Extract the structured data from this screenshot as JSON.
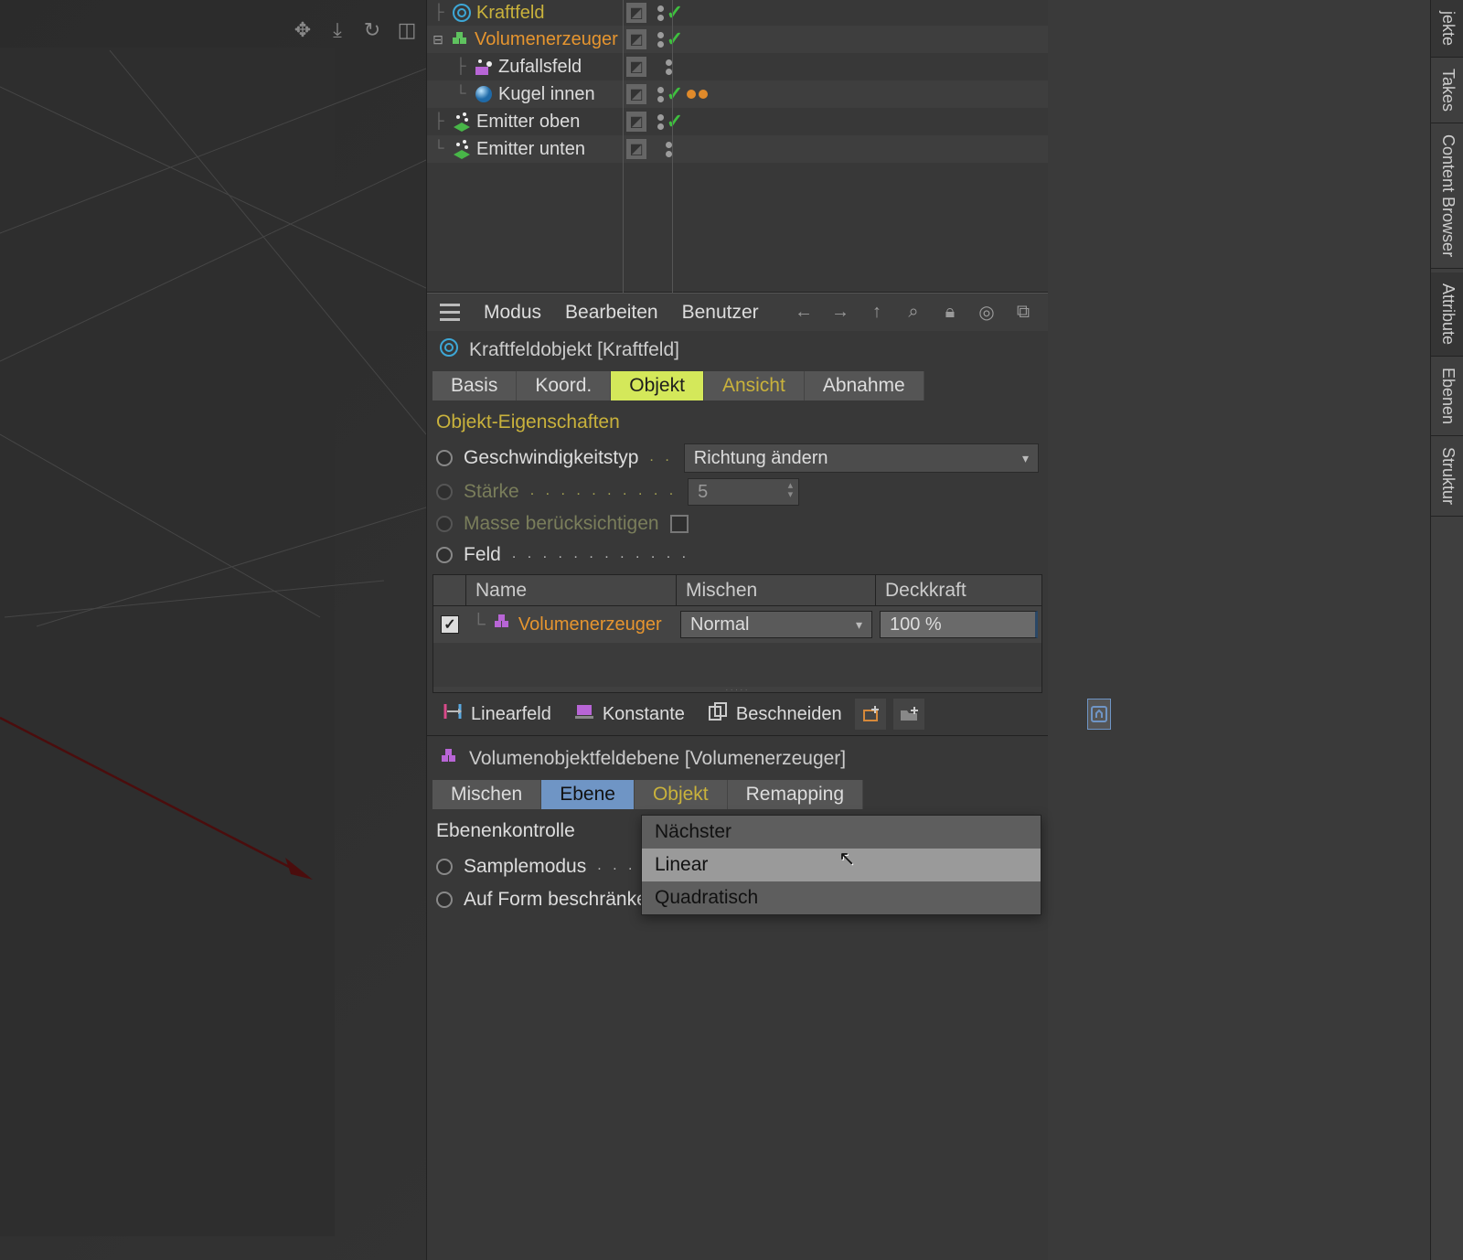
{
  "viewport_tools": [
    "move",
    "down",
    "refresh",
    "max"
  ],
  "objects": [
    {
      "name": "Kraftfeld",
      "icon": "forcefield",
      "sel": "gold",
      "indent": 0,
      "expand": "",
      "toggles": [
        "box",
        "dots",
        "check"
      ],
      "tags": []
    },
    {
      "name": "Volumenerzeuger",
      "icon": "volume",
      "sel": "sel",
      "indent": 0,
      "expand": "minus",
      "toggles": [
        "box",
        "dots",
        "check"
      ],
      "tags": []
    },
    {
      "name": "Zufallsfeld",
      "icon": "random",
      "sel": "",
      "indent": 1,
      "expand": "",
      "toggles": [
        "box",
        "dots"
      ],
      "tags": []
    },
    {
      "name": "Kugel innen",
      "icon": "sphere",
      "sel": "",
      "indent": 1,
      "expand": "",
      "toggles": [
        "box",
        "dots",
        "check"
      ],
      "tags": [
        "mat"
      ]
    },
    {
      "name": "Emitter oben",
      "icon": "emitter",
      "sel": "",
      "indent": 0,
      "expand": "",
      "toggles": [
        "box",
        "dots",
        "check"
      ],
      "tags": []
    },
    {
      "name": "Emitter unten",
      "icon": "emitter",
      "sel": "",
      "indent": 0,
      "expand": "",
      "toggles": [
        "box",
        "dots"
      ],
      "tags": []
    }
  ],
  "am_menu": {
    "items": [
      "Modus",
      "Bearbeiten",
      "Benutzer"
    ]
  },
  "am_title": "Kraftfeldobjekt [Kraftfeld]",
  "tabs1": [
    {
      "l": "Basis",
      "cls": ""
    },
    {
      "l": "Koord.",
      "cls": ""
    },
    {
      "l": "Objekt",
      "cls": "active"
    },
    {
      "l": "Ansicht",
      "cls": "yellowtext"
    },
    {
      "l": "Abnahme",
      "cls": ""
    }
  ],
  "section1": "Objekt-Eigenschaften",
  "props": {
    "speedtype_lbl": "Geschwindigkeitstyp",
    "speedtype_val": "Richtung ändern",
    "strength_lbl": "Stärke",
    "strength_val": "5",
    "mass_lbl": "Masse berücksichtigen",
    "field_lbl": "Feld"
  },
  "ft_head": {
    "c1": "Name",
    "c2": "Mischen",
    "c3": "Deckkraft"
  },
  "ft_row": {
    "name": "Volumenerzeuger",
    "mix": "Normal",
    "opac": "100 %"
  },
  "toolbar2": [
    {
      "l": "Linearfeld",
      "icon": "linearfield"
    },
    {
      "l": "Konstante",
      "icon": "const"
    },
    {
      "l": "Beschneiden",
      "icon": "clip"
    }
  ],
  "am_title2": "Volumenobjektfeldebene [Volumenerzeuger]",
  "tabs2": [
    {
      "l": "Mischen",
      "cls": ""
    },
    {
      "l": "Ebene",
      "cls": "blue"
    },
    {
      "l": "Objekt",
      "cls": "yellowtext"
    },
    {
      "l": "Remapping",
      "cls": ""
    }
  ],
  "section2": "Ebenenkontrolle",
  "props2": {
    "sample_lbl": "Samplemodus",
    "sample_val": "Linear",
    "restrict_lbl": "Auf Form beschränken"
  },
  "menu_items": [
    "Nächster",
    "Linear",
    "Quadratisch"
  ],
  "right_tabs": [
    "jekte",
    "Takes",
    "Content Browser",
    "Attribute",
    "Ebenen",
    "Struktur"
  ]
}
